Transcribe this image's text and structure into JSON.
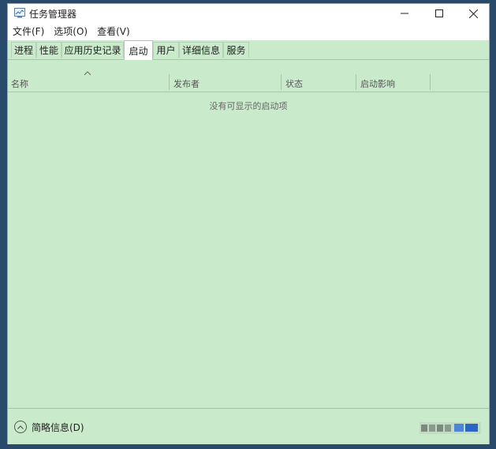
{
  "window": {
    "title": "任务管理器"
  },
  "menu": [
    {
      "label": "文件(F)"
    },
    {
      "label": "选项(O)"
    },
    {
      "label": "查看(V)"
    }
  ],
  "tabs": [
    {
      "label": "进程"
    },
    {
      "label": "性能"
    },
    {
      "label": "应用历史记录"
    },
    {
      "label": "启动",
      "active": true
    },
    {
      "label": "用户"
    },
    {
      "label": "详细信息"
    },
    {
      "label": "服务"
    }
  ],
  "columns": [
    {
      "label": "名称"
    },
    {
      "label": "发布者"
    },
    {
      "label": "状态"
    },
    {
      "label": "启动影响"
    }
  ],
  "empty_message": "没有可显示的启动项",
  "footer": {
    "collapse_label": "简略信息(D)"
  },
  "colors": {
    "content_bg": "#c9ebcb",
    "desktop_bg": "#2a4a6c"
  },
  "icons": {
    "app": "task-manager-icon",
    "minimize": "minimize-icon",
    "maximize": "maximize-icon",
    "close": "close-icon",
    "sort": "sort-up-arrow-icon",
    "collapse": "chevron-up-circle-icon"
  }
}
